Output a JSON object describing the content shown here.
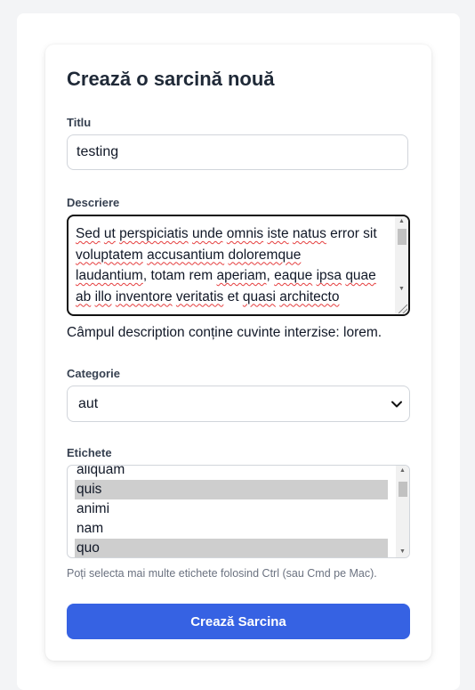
{
  "form": {
    "heading": "Crează o sarcină nouă",
    "title_label": "Titlu",
    "title_value": "testing",
    "description_label": "Descriere",
    "description_error": "Câmpul description conține cuvinte interzise: lorem.",
    "category_label": "Categorie",
    "category_selected": "aut",
    "tags_label": "Etichete",
    "tags_hint": "Poți selecta mai multe etichete folosind Ctrl (sau Cmd pe Mac).",
    "submit_label": "Crează Sarcina"
  },
  "description_lines": [
    [
      [
        "Sed",
        true
      ],
      [
        " ",
        false
      ],
      [
        "ut",
        true
      ],
      [
        " ",
        false
      ],
      [
        "perspiciatis",
        true
      ],
      [
        " ",
        false
      ],
      [
        "unde",
        true
      ],
      [
        " ",
        false
      ],
      [
        "omnis",
        true
      ],
      [
        " ",
        false
      ],
      [
        "iste",
        true
      ],
      [
        " ",
        false
      ],
      [
        "natus",
        true
      ],
      [
        " error sit",
        false
      ]
    ],
    [
      [
        "voluptatem",
        true
      ],
      [
        " ",
        false
      ],
      [
        "accusantium",
        true
      ],
      [
        " ",
        false
      ],
      [
        "doloremque",
        true
      ]
    ],
    [
      [
        "laudantium",
        true
      ],
      [
        ", totam rem ",
        false
      ],
      [
        "aperiam",
        true
      ],
      [
        ", ",
        false
      ],
      [
        "eaque",
        true
      ],
      [
        " ",
        false
      ],
      [
        "ipsa",
        true
      ],
      [
        " ",
        false
      ],
      [
        "quae",
        true
      ]
    ],
    [
      [
        "ab",
        true
      ],
      [
        " ",
        false
      ],
      [
        "illo",
        true
      ],
      [
        " ",
        false
      ],
      [
        "inventore",
        true
      ],
      [
        " ",
        false
      ],
      [
        "veritatis",
        true
      ],
      [
        " et ",
        false
      ],
      [
        "quasi",
        true
      ],
      [
        " ",
        false
      ],
      [
        "architecto",
        true
      ]
    ]
  ],
  "tags": [
    {
      "label": "aliquam",
      "selected": false
    },
    {
      "label": "quis",
      "selected": true
    },
    {
      "label": "animi",
      "selected": false
    },
    {
      "label": "nam",
      "selected": false
    },
    {
      "label": "quo",
      "selected": true
    }
  ],
  "colors": {
    "primary_button": "#3662e3",
    "selected_option": "#cecece",
    "page_background": "#f3f4f6"
  }
}
